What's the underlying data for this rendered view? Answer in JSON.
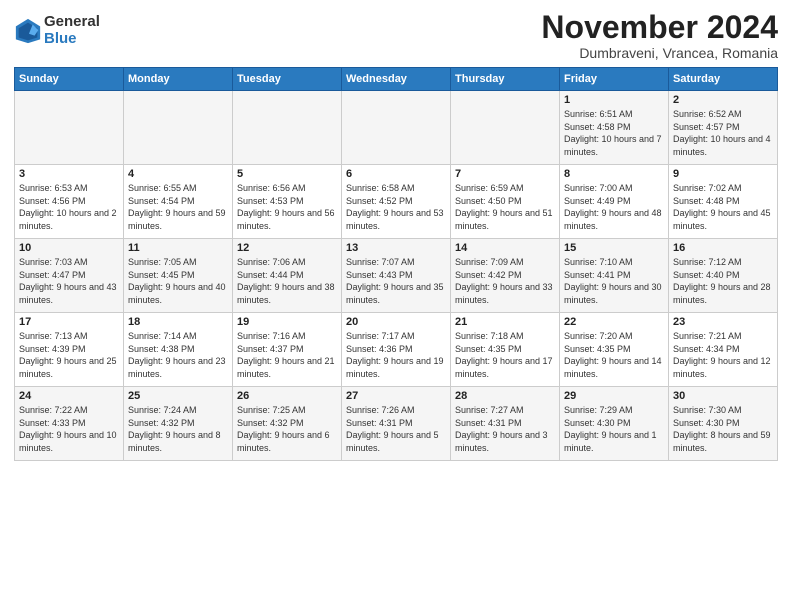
{
  "header": {
    "logo_general": "General",
    "logo_blue": "Blue",
    "month_title": "November 2024",
    "location": "Dumbraveni, Vrancea, Romania"
  },
  "weekdays": [
    "Sunday",
    "Monday",
    "Tuesday",
    "Wednesday",
    "Thursday",
    "Friday",
    "Saturday"
  ],
  "weeks": [
    [
      {
        "day": "",
        "info": ""
      },
      {
        "day": "",
        "info": ""
      },
      {
        "day": "",
        "info": ""
      },
      {
        "day": "",
        "info": ""
      },
      {
        "day": "",
        "info": ""
      },
      {
        "day": "1",
        "info": "Sunrise: 6:51 AM\nSunset: 4:58 PM\nDaylight: 10 hours and 7 minutes."
      },
      {
        "day": "2",
        "info": "Sunrise: 6:52 AM\nSunset: 4:57 PM\nDaylight: 10 hours and 4 minutes."
      }
    ],
    [
      {
        "day": "3",
        "info": "Sunrise: 6:53 AM\nSunset: 4:56 PM\nDaylight: 10 hours and 2 minutes."
      },
      {
        "day": "4",
        "info": "Sunrise: 6:55 AM\nSunset: 4:54 PM\nDaylight: 9 hours and 59 minutes."
      },
      {
        "day": "5",
        "info": "Sunrise: 6:56 AM\nSunset: 4:53 PM\nDaylight: 9 hours and 56 minutes."
      },
      {
        "day": "6",
        "info": "Sunrise: 6:58 AM\nSunset: 4:52 PM\nDaylight: 9 hours and 53 minutes."
      },
      {
        "day": "7",
        "info": "Sunrise: 6:59 AM\nSunset: 4:50 PM\nDaylight: 9 hours and 51 minutes."
      },
      {
        "day": "8",
        "info": "Sunrise: 7:00 AM\nSunset: 4:49 PM\nDaylight: 9 hours and 48 minutes."
      },
      {
        "day": "9",
        "info": "Sunrise: 7:02 AM\nSunset: 4:48 PM\nDaylight: 9 hours and 45 minutes."
      }
    ],
    [
      {
        "day": "10",
        "info": "Sunrise: 7:03 AM\nSunset: 4:47 PM\nDaylight: 9 hours and 43 minutes."
      },
      {
        "day": "11",
        "info": "Sunrise: 7:05 AM\nSunset: 4:45 PM\nDaylight: 9 hours and 40 minutes."
      },
      {
        "day": "12",
        "info": "Sunrise: 7:06 AM\nSunset: 4:44 PM\nDaylight: 9 hours and 38 minutes."
      },
      {
        "day": "13",
        "info": "Sunrise: 7:07 AM\nSunset: 4:43 PM\nDaylight: 9 hours and 35 minutes."
      },
      {
        "day": "14",
        "info": "Sunrise: 7:09 AM\nSunset: 4:42 PM\nDaylight: 9 hours and 33 minutes."
      },
      {
        "day": "15",
        "info": "Sunrise: 7:10 AM\nSunset: 4:41 PM\nDaylight: 9 hours and 30 minutes."
      },
      {
        "day": "16",
        "info": "Sunrise: 7:12 AM\nSunset: 4:40 PM\nDaylight: 9 hours and 28 minutes."
      }
    ],
    [
      {
        "day": "17",
        "info": "Sunrise: 7:13 AM\nSunset: 4:39 PM\nDaylight: 9 hours and 25 minutes."
      },
      {
        "day": "18",
        "info": "Sunrise: 7:14 AM\nSunset: 4:38 PM\nDaylight: 9 hours and 23 minutes."
      },
      {
        "day": "19",
        "info": "Sunrise: 7:16 AM\nSunset: 4:37 PM\nDaylight: 9 hours and 21 minutes."
      },
      {
        "day": "20",
        "info": "Sunrise: 7:17 AM\nSunset: 4:36 PM\nDaylight: 9 hours and 19 minutes."
      },
      {
        "day": "21",
        "info": "Sunrise: 7:18 AM\nSunset: 4:35 PM\nDaylight: 9 hours and 17 minutes."
      },
      {
        "day": "22",
        "info": "Sunrise: 7:20 AM\nSunset: 4:35 PM\nDaylight: 9 hours and 14 minutes."
      },
      {
        "day": "23",
        "info": "Sunrise: 7:21 AM\nSunset: 4:34 PM\nDaylight: 9 hours and 12 minutes."
      }
    ],
    [
      {
        "day": "24",
        "info": "Sunrise: 7:22 AM\nSunset: 4:33 PM\nDaylight: 9 hours and 10 minutes."
      },
      {
        "day": "25",
        "info": "Sunrise: 7:24 AM\nSunset: 4:32 PM\nDaylight: 9 hours and 8 minutes."
      },
      {
        "day": "26",
        "info": "Sunrise: 7:25 AM\nSunset: 4:32 PM\nDaylight: 9 hours and 6 minutes."
      },
      {
        "day": "27",
        "info": "Sunrise: 7:26 AM\nSunset: 4:31 PM\nDaylight: 9 hours and 5 minutes."
      },
      {
        "day": "28",
        "info": "Sunrise: 7:27 AM\nSunset: 4:31 PM\nDaylight: 9 hours and 3 minutes."
      },
      {
        "day": "29",
        "info": "Sunrise: 7:29 AM\nSunset: 4:30 PM\nDaylight: 9 hours and 1 minute."
      },
      {
        "day": "30",
        "info": "Sunrise: 7:30 AM\nSunset: 4:30 PM\nDaylight: 8 hours and 59 minutes."
      }
    ]
  ]
}
